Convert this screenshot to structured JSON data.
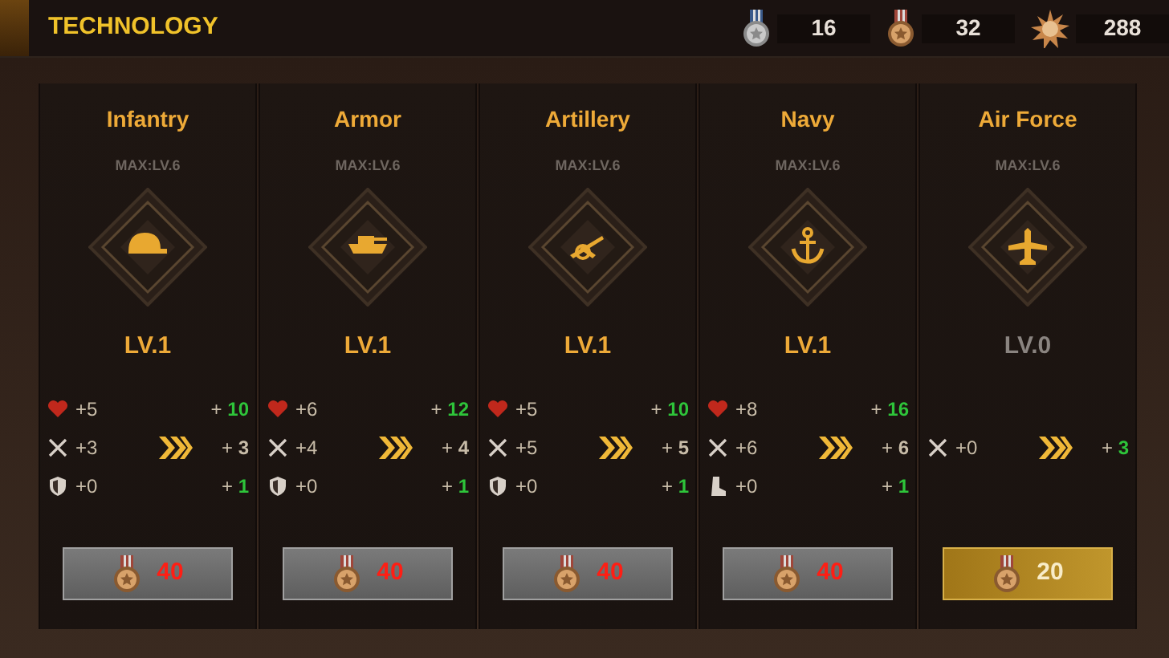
{
  "header": {
    "title": "TECHNOLOGY",
    "currencies": [
      {
        "kind": "blue-ribbon-medal",
        "amount": "16"
      },
      {
        "kind": "red-ribbon-medal",
        "amount": "32"
      },
      {
        "kind": "star-badge",
        "amount": "288"
      }
    ]
  },
  "branches": [
    {
      "name": "Infantry",
      "max_level": "MAX:LV.6",
      "kind": "helmet",
      "level": "LV.1",
      "researched": true,
      "stats": [
        {
          "kind": "health",
          "current": "+5",
          "next_sign": "+",
          "next_value": "10",
          "increased": true
        },
        {
          "kind": "attack",
          "current": "+3",
          "next_sign": "+",
          "next_value": "3",
          "increased": false
        },
        {
          "kind": "defense",
          "current": "+0",
          "next_sign": "+",
          "next_value": "1",
          "increased": true
        }
      ],
      "cost": "40",
      "affordable": false
    },
    {
      "name": "Armor",
      "max_level": "MAX:LV.6",
      "kind": "tank",
      "level": "LV.1",
      "researched": true,
      "stats": [
        {
          "kind": "health",
          "current": "+6",
          "next_sign": "+",
          "next_value": "12",
          "increased": true
        },
        {
          "kind": "attack",
          "current": "+4",
          "next_sign": "+",
          "next_value": "4",
          "increased": false
        },
        {
          "kind": "defense",
          "current": "+0",
          "next_sign": "+",
          "next_value": "1",
          "increased": true
        }
      ],
      "cost": "40",
      "affordable": false
    },
    {
      "name": "Artillery",
      "max_level": "MAX:LV.6",
      "kind": "cannon",
      "level": "LV.1",
      "researched": true,
      "stats": [
        {
          "kind": "health",
          "current": "+5",
          "next_sign": "+",
          "next_value": "10",
          "increased": true
        },
        {
          "kind": "attack",
          "current": "+5",
          "next_sign": "+",
          "next_value": "5",
          "increased": false
        },
        {
          "kind": "defense",
          "current": "+0",
          "next_sign": "+",
          "next_value": "1",
          "increased": true
        }
      ],
      "cost": "40",
      "affordable": false
    },
    {
      "name": "Navy",
      "max_level": "MAX:LV.6",
      "kind": "anchor",
      "level": "LV.1",
      "researched": true,
      "stats": [
        {
          "kind": "health",
          "current": "+8",
          "next_sign": "+",
          "next_value": "16",
          "increased": true
        },
        {
          "kind": "attack",
          "current": "+6",
          "next_sign": "+",
          "next_value": "6",
          "increased": false
        },
        {
          "kind": "speed",
          "current": "+0",
          "next_sign": "+",
          "next_value": "1",
          "increased": true
        }
      ],
      "cost": "40",
      "affordable": false
    },
    {
      "name": "Air Force",
      "max_level": "MAX:LV.6",
      "kind": "plane",
      "level": "LV.0",
      "researched": false,
      "stats": [
        {
          "kind": "attack",
          "current": "+0",
          "next_sign": "+",
          "next_value": "3",
          "increased": true
        }
      ],
      "cost": "20",
      "affordable": true
    }
  ]
}
